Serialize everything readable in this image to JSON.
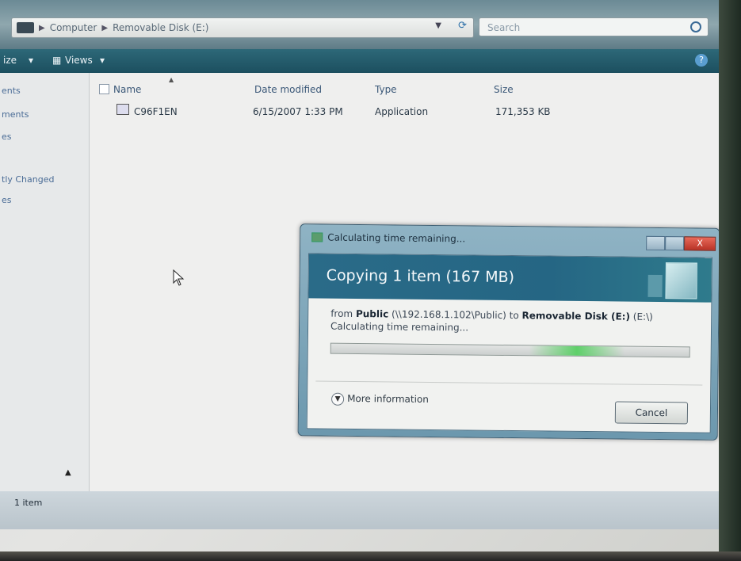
{
  "address_bar": {
    "crumbs": [
      "Computer",
      "Removable Disk (E:)"
    ]
  },
  "search": {
    "placeholder": "Search"
  },
  "toolbar": {
    "organize_label": "ize",
    "views_label": "Views"
  },
  "nav_pane": {
    "items": [
      "ents",
      "ments",
      "es",
      "",
      "tly Changed",
      "es"
    ]
  },
  "file_list": {
    "columns": [
      "Name",
      "Date modified",
      "Type",
      "Size"
    ],
    "rows": [
      {
        "name": "C96F1EN",
        "date_modified": "6/15/2007 1:33 PM",
        "type": "Application",
        "size": "171,353 KB"
      }
    ]
  },
  "status_bar": {
    "text": "1 item"
  },
  "copy_dialog": {
    "title": "Calculating time remaining...",
    "heading": "Copying 1 item (167 MB)",
    "from_label": "from",
    "source_name": "Public",
    "source_path": "(\\\\192.168.1.102\\Public)",
    "to_label": "to",
    "dest_name": "Removable Disk (E:)",
    "dest_path": "(E:\\)",
    "status": "Calculating time remaining...",
    "more_info_label": "More information",
    "cancel_label": "Cancel",
    "close_glyph": "X"
  },
  "colors": {
    "dialog_header": "#2a6b88",
    "toolbar": "#1c4f5f",
    "progress_glow": "#5fd06a"
  }
}
